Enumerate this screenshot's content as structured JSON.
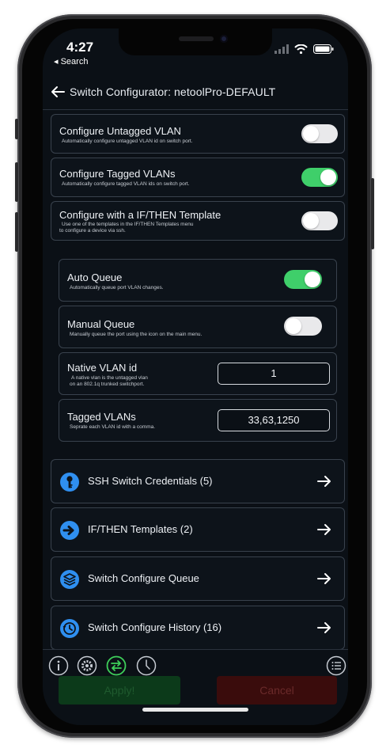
{
  "status": {
    "time": "4:27",
    "back_label": "◂ Search"
  },
  "navbar": {
    "title": "Switch Configurator: netoolPro-DEFAULT"
  },
  "settings": [
    {
      "title": "Configure Untagged VLAN",
      "subtitle": "Automatically configure untagged VLAN id on switch port.",
      "enabled": false
    },
    {
      "title": "Configure Tagged VLANs",
      "subtitle": "Automatically configure tagged VLAN ids on switch port.",
      "enabled": true
    },
    {
      "title": "Configure with a IF/THEN Template",
      "subtitle": "Use one of the templates in the IF/THEN Templates menu",
      "subtitle2": "to configure a device via ssh.",
      "enabled": false
    }
  ],
  "queue": {
    "auto": {
      "title": "Auto Queue",
      "subtitle": "Automatically queue port VLAN changes.",
      "enabled": true
    },
    "manual": {
      "title": "Manual Queue",
      "subtitle": "Manually queue the port using the icon on the main menu.",
      "enabled": false
    },
    "native_vlan": {
      "title": "Native VLAN id",
      "subtitle": "A native vlan is the untagged vlan",
      "subtitle2": "on an 802.1q trunked switchport.",
      "value": "1"
    },
    "tagged_vlans": {
      "title": "Tagged VLANs",
      "subtitle": "Seprate each VLAN id with a comma.",
      "value": "33,63,1250"
    }
  },
  "menu": [
    {
      "label": "SSH Switch Credentials (5)",
      "icon": "key-icon"
    },
    {
      "label": "IF/THEN Templates (2)",
      "icon": "arrow-right-circle-icon"
    },
    {
      "label": "Switch Configure Queue",
      "icon": "layers-icon"
    },
    {
      "label": "Switch Configure History (16)",
      "icon": "history-icon"
    }
  ],
  "bottom_buttons": {
    "apply": "Apply!",
    "cancel": "Cancel"
  },
  "colors": {
    "accent_blue": "#2f8ff0",
    "toggle_on": "#3fcf6a",
    "accent_green": "#3ecf5a",
    "background": "#0b1016"
  }
}
